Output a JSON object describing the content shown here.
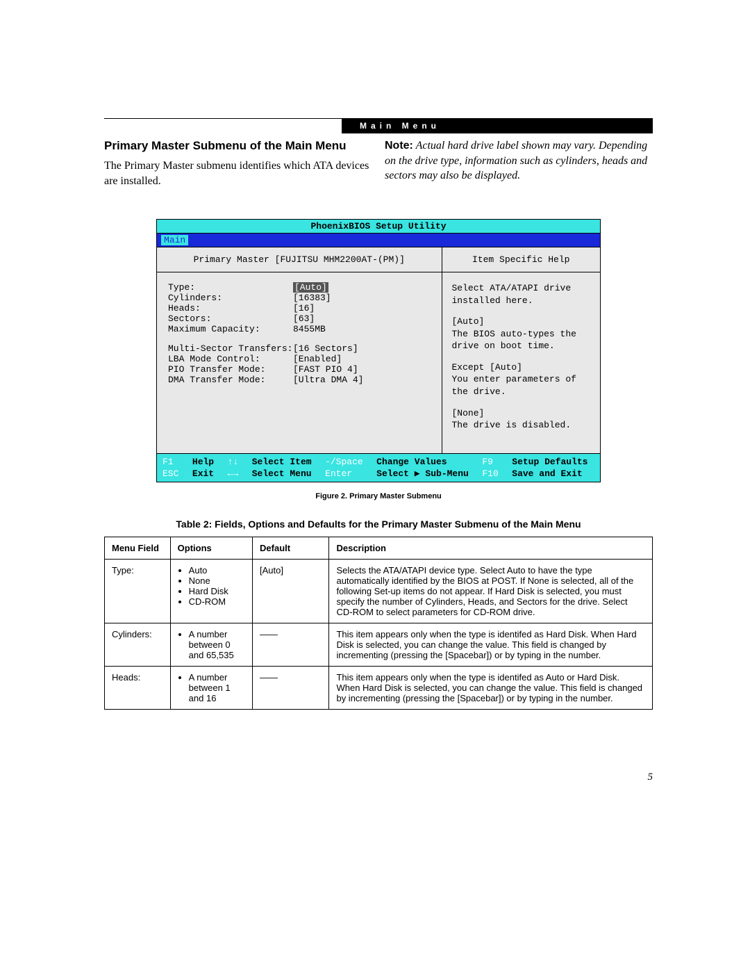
{
  "header_bar": "Main Menu",
  "left_col": {
    "heading": "Primary Master Submenu of the Main Menu",
    "body": "The Primary Master submenu identifies which ATA devices are installed."
  },
  "right_col": {
    "note_label": "Note:",
    "note_text": " Actual hard drive label shown may vary.  Depending on the drive type, information such as cylinders, heads and sectors may also be displayed."
  },
  "bios": {
    "title": "PhoenixBIOS Setup Utility",
    "tab": "Main",
    "left_header": "Primary Master [FUJITSU MHM2200AT-(PM)]",
    "right_header": "Item Specific Help",
    "rows_a": [
      {
        "label": "Type:",
        "value": "[Auto]",
        "highlight": true
      },
      {
        "label": "Cylinders:",
        "value": "[16383]"
      },
      {
        "label": "Heads:",
        "value": "[16]"
      },
      {
        "label": "Sectors:",
        "value": "[63]"
      },
      {
        "label": "Maximum Capacity:",
        "value": "8455MB"
      }
    ],
    "rows_b": [
      {
        "label": "Multi-Sector Transfers:",
        "value": "[16 Sectors]"
      },
      {
        "label": "LBA Mode Control:",
        "value": "[Enabled]"
      },
      {
        "label": "PIO Transfer Mode:",
        "value": "[FAST PIO 4]"
      },
      {
        "label": "DMA Transfer Mode:",
        "value": "[Ultra DMA 4]"
      }
    ],
    "help": [
      "Select ATA/ATAPI drive installed here.",
      "[Auto]\nThe BIOS auto-types the drive on boot time.",
      "Except [Auto]\nYou enter parameters of the drive.",
      "[None]\nThe drive is disabled."
    ],
    "footer": [
      {
        "k": "F1",
        "l": "Help"
      },
      {
        "k": "↑↓",
        "l": "Select Item"
      },
      {
        "k": "-/Space",
        "l": "Change Values"
      },
      {
        "k": "F9",
        "l": "Setup Defaults"
      },
      {
        "k": "ESC",
        "l": "Exit"
      },
      {
        "k": "←→",
        "l": "Select Menu"
      },
      {
        "k": "Enter",
        "l": "Select ▶ Sub-Menu"
      },
      {
        "k": "F10",
        "l": "Save and Exit"
      }
    ]
  },
  "fig_caption": "Figure 2.  Primary Master Submenu",
  "table_title": "Table 2: Fields, Options and Defaults for the Primary Master Submenu of the Main Menu",
  "table": {
    "headers": [
      "Menu Field",
      "Options",
      "Default",
      "Description"
    ],
    "rows": [
      {
        "field": "Type:",
        "options": [
          "Auto",
          "None",
          "Hard Disk",
          "CD-ROM"
        ],
        "default": "[Auto]",
        "desc": "Selects the ATA/ATAPI device type. Select Auto to have the type automatically identified by the BIOS at POST. If None is selected, all of the following Set-up items do not appear. If Hard Disk is selected, you must specify the number of Cylinders, Heads, and Sectors for the drive. Select CD-ROM to select parameters for CD-ROM drive."
      },
      {
        "field": "Cylinders:",
        "options": [
          "A number between 0 and 65,535"
        ],
        "default": "——",
        "desc": "This item appears only when the type is identifed as Hard Disk. When Hard Disk is selected, you can change the value. This field is changed by incrementing (pressing the [Spacebar]) or by typing in the number."
      },
      {
        "field": "Heads:",
        "options": [
          "A number between 1 and 16"
        ],
        "default": "——",
        "desc": "This item appears only when the type is identifed as Auto or Hard Disk. When Hard Disk is selected, you can change the value. This field is changed by incrementing (pressing the [Spacebar]) or by typing in the number."
      }
    ]
  },
  "page_number": "5"
}
